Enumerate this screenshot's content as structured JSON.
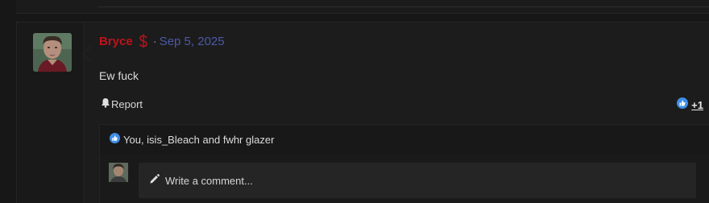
{
  "post": {
    "username": "Bryce",
    "separator": "·",
    "date": "Sep 5, 2025",
    "message": "Ew fuck",
    "report_label": "Report",
    "reaction_count": "+1",
    "reactions_text": "You, isis_Bleach and fwhr glazer"
  },
  "comment": {
    "placeholder": "Write a comment..."
  },
  "icons": {
    "badge": "dollar-sign-icon",
    "report": "bell-icon",
    "reaction": "thumbs-up-icon",
    "comment": "pencil-icon"
  },
  "colors": {
    "username": "#c0121a",
    "date": "#4c5aa6",
    "like": "#3f8ee8"
  }
}
